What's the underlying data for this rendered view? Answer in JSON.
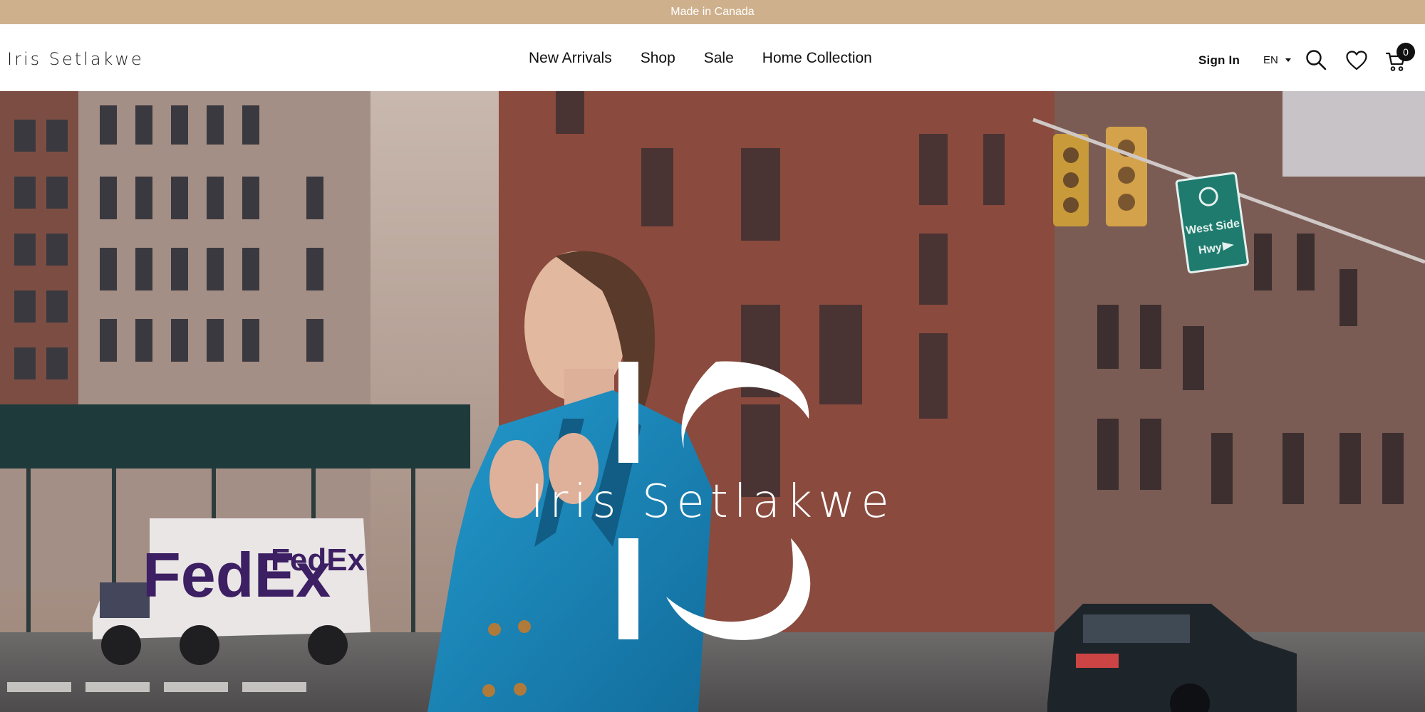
{
  "announcement": {
    "text": "Made in Canada"
  },
  "header": {
    "logo_text": "Iris Setlakwe",
    "nav": [
      "New Arrivals",
      "Shop",
      "Sale",
      "Home Collection"
    ],
    "sign_in": "Sign In",
    "language": "EN",
    "cart_count": "0",
    "icons": [
      "search-icon",
      "heart-icon",
      "cart-icon",
      "chevron-down-icon"
    ]
  },
  "hero": {
    "logo_text": "Iris Setlakwe",
    "van_brand": "FedEx",
    "street_sign": [
      "West Side",
      "Hwy"
    ]
  },
  "colors": {
    "announcement_bg": "#cfb08c",
    "header_bg": "#ffffff",
    "jacket_blue": "#1a85b8",
    "brick": "#8a4a3d"
  }
}
